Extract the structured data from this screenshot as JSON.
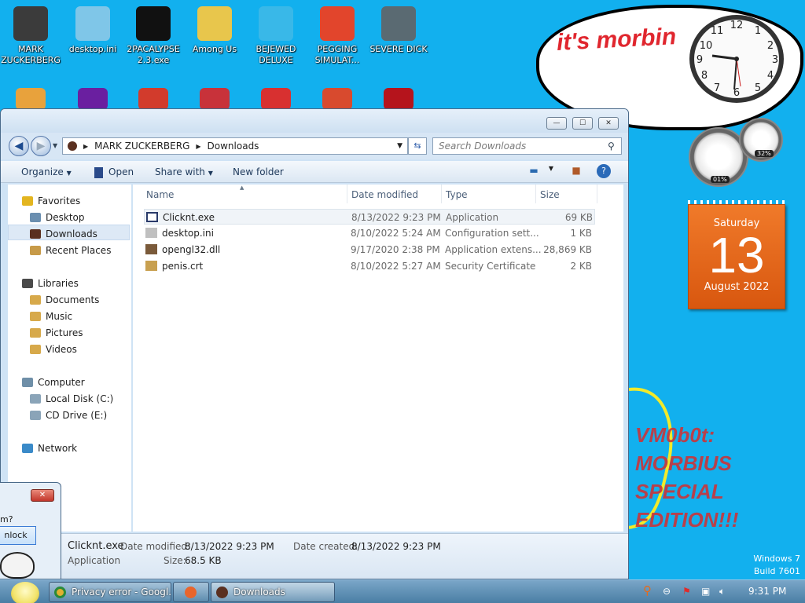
{
  "desktop": {
    "icons_row1": [
      {
        "label": "MARK ZUCKERBERG",
        "icon": "folder-person-icon",
        "color": "#3b3b3b"
      },
      {
        "label": "desktop.ini",
        "icon": "settings-file-icon",
        "color": "#7fc6e8"
      },
      {
        "label": "2PACALYPSE 2.3.exe",
        "icon": "console-app-icon",
        "color": "#111111"
      },
      {
        "label": "Among Us",
        "icon": "shortcut-folder-icon",
        "color": "#e8c64c"
      },
      {
        "label": "BEJEWED DELUXE",
        "icon": "gem-icon",
        "color": "#39b8e8"
      },
      {
        "label": "PEGGING SIMULAT...",
        "icon": "p-badge-icon",
        "color": "#e2452c"
      },
      {
        "label": "SEVERE DICK",
        "icon": "sd-gear-icon",
        "color": "#5a6a72"
      }
    ],
    "icons_row2": [
      {
        "icon": "photo-app-icon",
        "color": "#e8a23c"
      },
      {
        "icon": "yahoo-icon",
        "color": "#6a1fa0"
      },
      {
        "icon": "angry-bird-icon",
        "color": "#d23b2c"
      },
      {
        "icon": "angry-bird-icon",
        "color": "#c8323a"
      },
      {
        "icon": "opera-icon",
        "color": "#d83030"
      },
      {
        "icon": "p-badge-icon",
        "color": "#d84a2e"
      },
      {
        "icon": "flash-icon",
        "color": "#b5141c"
      }
    ],
    "bubble_text": "it's morbin",
    "gauges": [
      {
        "label": "01%"
      },
      {
        "label": "32%"
      }
    ],
    "calendar": {
      "day": "Saturday",
      "date": "13",
      "month": "August 2022"
    },
    "vm_text": "VM0b0t:\nMORBIUS\nSPECIAL\nEDITION!!!",
    "watermark": {
      "line1": "Windows 7",
      "line2": "Build 7601"
    }
  },
  "window": {
    "controls": {
      "minimize": "—",
      "maximize": "☐",
      "close": "✕"
    },
    "address": {
      "segment1": "MARK ZUCKERBERG",
      "segment2": "Downloads"
    },
    "search_placeholder": "Search Downloads",
    "toolbar": {
      "organize": "Organize",
      "open": "Open",
      "share_with": "Share with",
      "new_folder": "New folder"
    },
    "nav": [
      {
        "label": "Favorites",
        "icon": "star-icon",
        "color": "#e3b520"
      },
      {
        "label": "Desktop",
        "icon": "desktop-icon",
        "color": "#6b8fb0"
      },
      {
        "label": "Downloads",
        "icon": "downloads-folder-icon",
        "color": "#5a3020"
      },
      {
        "label": "Recent Places",
        "icon": "recent-places-icon",
        "color": "#c79a48"
      },
      {
        "label": "Libraries",
        "icon": "libraries-icon",
        "color": "#4a4a4a"
      },
      {
        "label": "Documents",
        "icon": "documents-icon",
        "color": "#d7a94a"
      },
      {
        "label": "Music",
        "icon": "music-icon",
        "color": "#d7a94a"
      },
      {
        "label": "Pictures",
        "icon": "pictures-icon",
        "color": "#d7a94a"
      },
      {
        "label": "Videos",
        "icon": "videos-icon",
        "color": "#d7a94a"
      },
      {
        "label": "Computer",
        "icon": "computer-icon",
        "color": "#6f8fa8"
      },
      {
        "label": "Local Disk (C:)",
        "icon": "disk-icon",
        "color": "#8aa4b8"
      },
      {
        "label": "CD Drive (E:)",
        "icon": "cd-drive-icon",
        "color": "#8aa4b8"
      },
      {
        "label": "Network",
        "icon": "network-icon",
        "color": "#3a8ac8"
      }
    ],
    "columns": {
      "name": "Name",
      "date": "Date modified",
      "type": "Type",
      "size": "Size"
    },
    "files": [
      {
        "name": "Clicknt.exe",
        "date": "8/13/2022 9:23 PM",
        "type": "Application",
        "size": "69 KB",
        "icon": "exe-icon",
        "color": "#2a3a6a"
      },
      {
        "name": "desktop.ini",
        "date": "8/10/2022 5:24 AM",
        "type": "Configuration sett...",
        "size": "1 KB",
        "icon": "ini-file-icon",
        "color": "#c0c0c0"
      },
      {
        "name": "opengl32.dll",
        "date": "9/17/2020 2:38 PM",
        "type": "Application extens...",
        "size": "28,869 KB",
        "icon": "dll-file-icon",
        "color": "#7a5a3a"
      },
      {
        "name": "penis.crt",
        "date": "8/10/2022 5:27 AM",
        "type": "Security Certificate",
        "size": "2 KB",
        "icon": "certificate-icon",
        "color": "#c8a050"
      }
    ],
    "details": {
      "name": "Clicknt.exe",
      "type": "Application",
      "modified_label": "Date modified:",
      "modified_value": "8/13/2022 9:23 PM",
      "created_label": "Date created:",
      "created_value": "8/13/2022 9:23 PM",
      "size_label": "Size:",
      "size_value": "68.5 KB"
    }
  },
  "dialog": {
    "close": "✕",
    "text": "m?",
    "button": "nlock"
  },
  "taskbar": {
    "tasks": [
      {
        "label": "Privacy error - Googl...",
        "icon": "chrome-icon",
        "color": "#e0b030"
      },
      {
        "label": "",
        "icon": "firefox-icon",
        "color": "#e8652c"
      },
      {
        "label": "Downloads",
        "icon": "explorer-icon",
        "color": "#5a3020"
      }
    ],
    "time": "9:31 PM"
  }
}
